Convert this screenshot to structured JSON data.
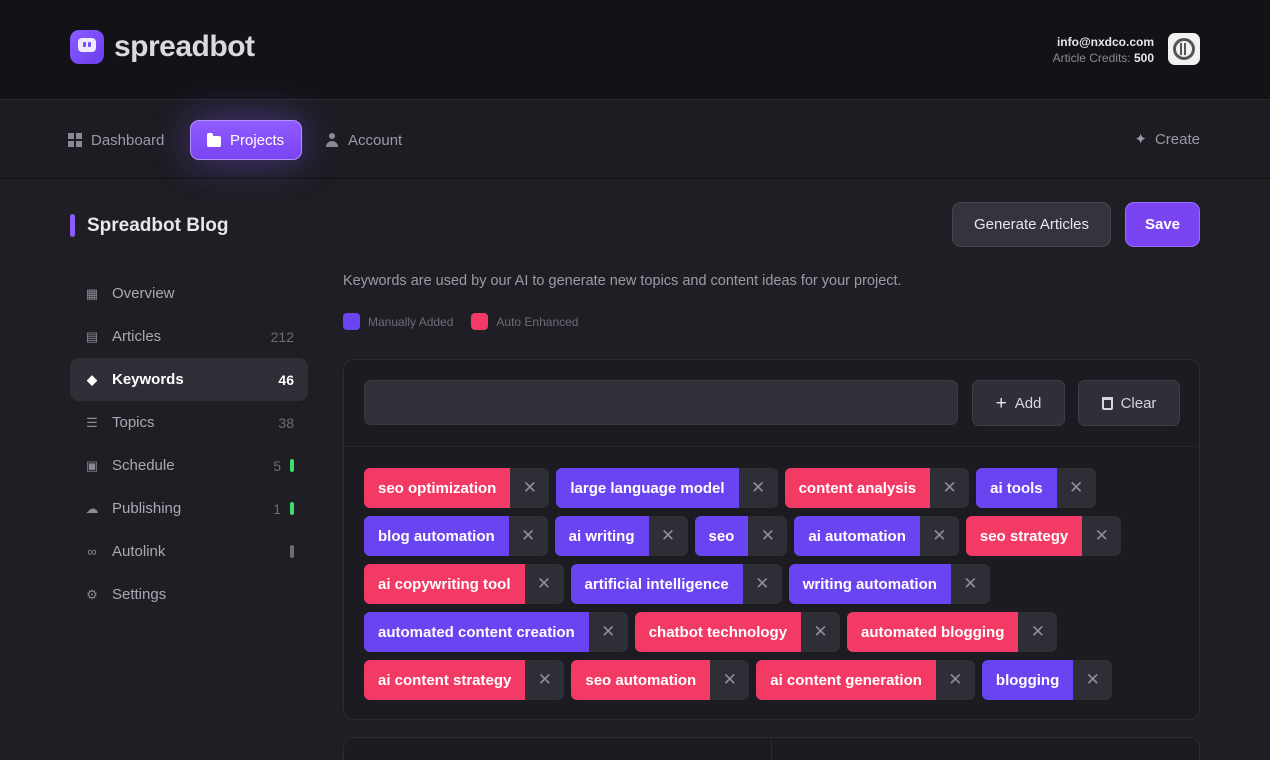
{
  "app": {
    "name": "spreadbot"
  },
  "user": {
    "email": "info@nxdco.com",
    "credits_label": "Article Credits:",
    "credits_value": "500"
  },
  "nav": {
    "items": [
      {
        "label": "Dashboard",
        "icon": "grid-icon",
        "active": false
      },
      {
        "label": "Projects",
        "icon": "folder-icon",
        "active": true
      },
      {
        "label": "Account",
        "icon": "user-icon",
        "active": false
      }
    ],
    "create_label": "Create"
  },
  "project": {
    "title": "Spreadbot Blog"
  },
  "sidebar": {
    "items": [
      {
        "label": "Overview",
        "icon": "grid-icon",
        "count": ""
      },
      {
        "label": "Articles",
        "icon": "newspaper-icon",
        "count": "212"
      },
      {
        "label": "Keywords",
        "icon": "tag-icon",
        "count": "46",
        "active": true
      },
      {
        "label": "Topics",
        "icon": "list-icon",
        "count": "38"
      },
      {
        "label": "Schedule",
        "icon": "calendar-edit-icon",
        "count": "5",
        "status": "#3ddc6b"
      },
      {
        "label": "Publishing",
        "icon": "cloud-upload-icon",
        "count": "1",
        "status": "#3ddc6b"
      },
      {
        "label": "Autolink",
        "icon": "link-icon",
        "count": "",
        "status": "#6d6d78"
      },
      {
        "label": "Settings",
        "icon": "gear-icon",
        "count": ""
      }
    ]
  },
  "actions": {
    "generate_label": "Generate Articles",
    "save_label": "Save"
  },
  "keywords": {
    "description": "Keywords are used by our AI to generate new topics and content ideas for your project.",
    "legend": {
      "manual": "Manually Added",
      "auto": "Auto Enhanced",
      "manual_color": "#6a44f0",
      "auto_color": "#f23a64"
    },
    "input_value": "",
    "add_label": "Add",
    "clear_label": "Clear",
    "rows": [
      [
        {
          "t": "seo optimization",
          "k": "a"
        },
        {
          "t": "large language model",
          "k": "m"
        },
        {
          "t": "content analysis",
          "k": "a"
        },
        {
          "t": "ai tools",
          "k": "m"
        }
      ],
      [
        {
          "t": "blog automation",
          "k": "m"
        },
        {
          "t": "ai writing",
          "k": "m"
        },
        {
          "t": "seo",
          "k": "m"
        },
        {
          "t": "ai automation",
          "k": "m"
        },
        {
          "t": "seo strategy",
          "k": "a"
        }
      ],
      [
        {
          "t": "ai copywriting tool",
          "k": "a"
        },
        {
          "t": "artificial intelligence",
          "k": "m"
        },
        {
          "t": "writing automation",
          "k": "m"
        }
      ],
      [
        {
          "t": "automated content creation",
          "k": "m"
        },
        {
          "t": "chatbot technology",
          "k": "a"
        },
        {
          "t": "automated blogging",
          "k": "a"
        }
      ],
      [
        {
          "t": "ai content strategy",
          "k": "a"
        },
        {
          "t": "seo automation",
          "k": "a"
        },
        {
          "t": "ai content generation",
          "k": "a"
        },
        {
          "t": "blogging",
          "k": "m"
        }
      ]
    ]
  }
}
